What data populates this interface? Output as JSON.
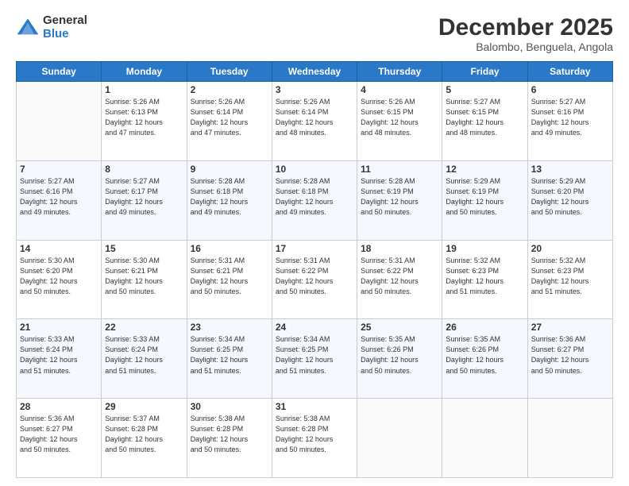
{
  "header": {
    "logo_line1": "General",
    "logo_line2": "Blue",
    "month": "December 2025",
    "location": "Balombo, Benguela, Angola"
  },
  "days_of_week": [
    "Sunday",
    "Monday",
    "Tuesday",
    "Wednesday",
    "Thursday",
    "Friday",
    "Saturday"
  ],
  "weeks": [
    [
      {
        "day": "",
        "info": ""
      },
      {
        "day": "1",
        "info": "Sunrise: 5:26 AM\nSunset: 6:13 PM\nDaylight: 12 hours\nand 47 minutes."
      },
      {
        "day": "2",
        "info": "Sunrise: 5:26 AM\nSunset: 6:14 PM\nDaylight: 12 hours\nand 47 minutes."
      },
      {
        "day": "3",
        "info": "Sunrise: 5:26 AM\nSunset: 6:14 PM\nDaylight: 12 hours\nand 48 minutes."
      },
      {
        "day": "4",
        "info": "Sunrise: 5:26 AM\nSunset: 6:15 PM\nDaylight: 12 hours\nand 48 minutes."
      },
      {
        "day": "5",
        "info": "Sunrise: 5:27 AM\nSunset: 6:15 PM\nDaylight: 12 hours\nand 48 minutes."
      },
      {
        "day": "6",
        "info": "Sunrise: 5:27 AM\nSunset: 6:16 PM\nDaylight: 12 hours\nand 49 minutes."
      }
    ],
    [
      {
        "day": "7",
        "info": "Sunrise: 5:27 AM\nSunset: 6:16 PM\nDaylight: 12 hours\nand 49 minutes."
      },
      {
        "day": "8",
        "info": "Sunrise: 5:27 AM\nSunset: 6:17 PM\nDaylight: 12 hours\nand 49 minutes."
      },
      {
        "day": "9",
        "info": "Sunrise: 5:28 AM\nSunset: 6:18 PM\nDaylight: 12 hours\nand 49 minutes."
      },
      {
        "day": "10",
        "info": "Sunrise: 5:28 AM\nSunset: 6:18 PM\nDaylight: 12 hours\nand 49 minutes."
      },
      {
        "day": "11",
        "info": "Sunrise: 5:28 AM\nSunset: 6:19 PM\nDaylight: 12 hours\nand 50 minutes."
      },
      {
        "day": "12",
        "info": "Sunrise: 5:29 AM\nSunset: 6:19 PM\nDaylight: 12 hours\nand 50 minutes."
      },
      {
        "day": "13",
        "info": "Sunrise: 5:29 AM\nSunset: 6:20 PM\nDaylight: 12 hours\nand 50 minutes."
      }
    ],
    [
      {
        "day": "14",
        "info": "Sunrise: 5:30 AM\nSunset: 6:20 PM\nDaylight: 12 hours\nand 50 minutes."
      },
      {
        "day": "15",
        "info": "Sunrise: 5:30 AM\nSunset: 6:21 PM\nDaylight: 12 hours\nand 50 minutes."
      },
      {
        "day": "16",
        "info": "Sunrise: 5:31 AM\nSunset: 6:21 PM\nDaylight: 12 hours\nand 50 minutes."
      },
      {
        "day": "17",
        "info": "Sunrise: 5:31 AM\nSunset: 6:22 PM\nDaylight: 12 hours\nand 50 minutes."
      },
      {
        "day": "18",
        "info": "Sunrise: 5:31 AM\nSunset: 6:22 PM\nDaylight: 12 hours\nand 50 minutes."
      },
      {
        "day": "19",
        "info": "Sunrise: 5:32 AM\nSunset: 6:23 PM\nDaylight: 12 hours\nand 51 minutes."
      },
      {
        "day": "20",
        "info": "Sunrise: 5:32 AM\nSunset: 6:23 PM\nDaylight: 12 hours\nand 51 minutes."
      }
    ],
    [
      {
        "day": "21",
        "info": "Sunrise: 5:33 AM\nSunset: 6:24 PM\nDaylight: 12 hours\nand 51 minutes."
      },
      {
        "day": "22",
        "info": "Sunrise: 5:33 AM\nSunset: 6:24 PM\nDaylight: 12 hours\nand 51 minutes."
      },
      {
        "day": "23",
        "info": "Sunrise: 5:34 AM\nSunset: 6:25 PM\nDaylight: 12 hours\nand 51 minutes."
      },
      {
        "day": "24",
        "info": "Sunrise: 5:34 AM\nSunset: 6:25 PM\nDaylight: 12 hours\nand 51 minutes."
      },
      {
        "day": "25",
        "info": "Sunrise: 5:35 AM\nSunset: 6:26 PM\nDaylight: 12 hours\nand 50 minutes."
      },
      {
        "day": "26",
        "info": "Sunrise: 5:35 AM\nSunset: 6:26 PM\nDaylight: 12 hours\nand 50 minutes."
      },
      {
        "day": "27",
        "info": "Sunrise: 5:36 AM\nSunset: 6:27 PM\nDaylight: 12 hours\nand 50 minutes."
      }
    ],
    [
      {
        "day": "28",
        "info": "Sunrise: 5:36 AM\nSunset: 6:27 PM\nDaylight: 12 hours\nand 50 minutes."
      },
      {
        "day": "29",
        "info": "Sunrise: 5:37 AM\nSunset: 6:28 PM\nDaylight: 12 hours\nand 50 minutes."
      },
      {
        "day": "30",
        "info": "Sunrise: 5:38 AM\nSunset: 6:28 PM\nDaylight: 12 hours\nand 50 minutes."
      },
      {
        "day": "31",
        "info": "Sunrise: 5:38 AM\nSunset: 6:28 PM\nDaylight: 12 hours\nand 50 minutes."
      },
      {
        "day": "",
        "info": ""
      },
      {
        "day": "",
        "info": ""
      },
      {
        "day": "",
        "info": ""
      }
    ]
  ]
}
